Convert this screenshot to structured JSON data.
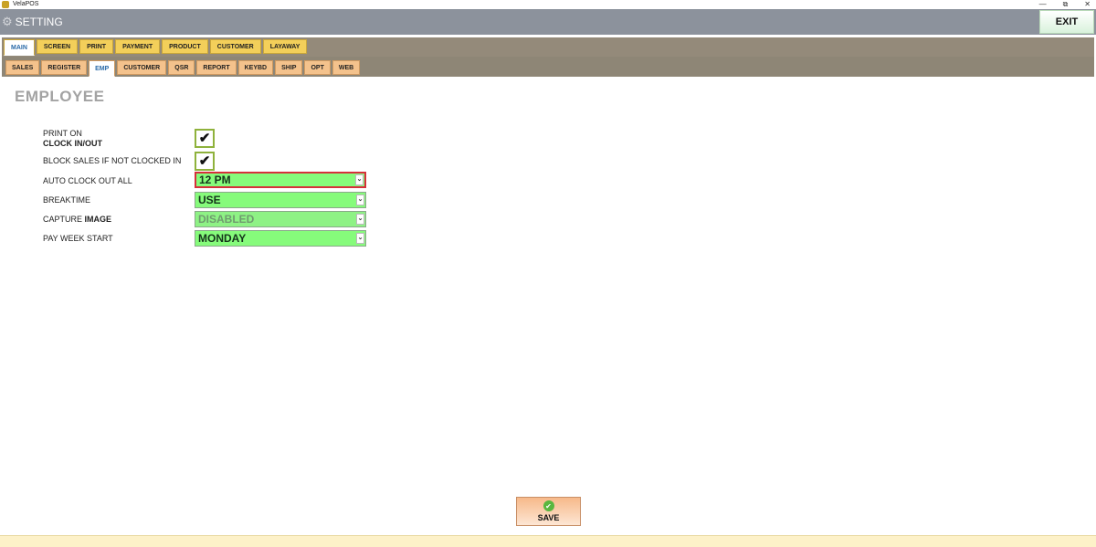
{
  "window": {
    "title": "VelaPOS",
    "controls": [
      "—",
      "⧉",
      "✕"
    ]
  },
  "header": {
    "title": "SETTING",
    "exit_label": "EXIT"
  },
  "tabs_main": [
    {
      "label": "MAIN",
      "active": true
    },
    {
      "label": "SCREEN",
      "active": false
    },
    {
      "label": "PRINT",
      "active": false
    },
    {
      "label": "PAYMENT",
      "active": false
    },
    {
      "label": "PRODUCT",
      "active": false
    },
    {
      "label": "CUSTOMER",
      "active": false
    },
    {
      "label": "LAYAWAY",
      "active": false
    }
  ],
  "tabs_sub": [
    {
      "label": "SALES",
      "active": false
    },
    {
      "label": "REGISTER",
      "active": false
    },
    {
      "label": "EMP",
      "active": true
    },
    {
      "label": "CUSTOMER",
      "active": false
    },
    {
      "label": "QSR",
      "active": false
    },
    {
      "label": "REPORT",
      "active": false
    },
    {
      "label": "KEYBD",
      "active": false
    },
    {
      "label": "SHIP",
      "active": false
    },
    {
      "label": "OPT",
      "active": false
    },
    {
      "label": "WEB",
      "active": false
    }
  ],
  "page": {
    "title": "EMPLOYEE"
  },
  "form": {
    "print_clock": {
      "label_line1": "PRINT ON",
      "label_line2": "CLOCK IN/OUT",
      "checked": true
    },
    "block_sales": {
      "label": "BLOCK SALES IF NOT CLOCKED IN",
      "checked": true
    },
    "auto_clock_out": {
      "label": "AUTO CLOCK OUT ALL",
      "value": "12 PM"
    },
    "breaktime": {
      "label": "BREAKTIME",
      "value": "USE"
    },
    "capture_image": {
      "label_pre": "CAPTURE ",
      "label_bold": "IMAGE",
      "value": "DISABLED"
    },
    "pay_week_start": {
      "label": "PAY WEEK START",
      "value": "MONDAY"
    }
  },
  "save": {
    "label": "SAVE"
  },
  "icons": {
    "checkmark": "✔",
    "chevron": "⌄",
    "gear": "⚙"
  }
}
